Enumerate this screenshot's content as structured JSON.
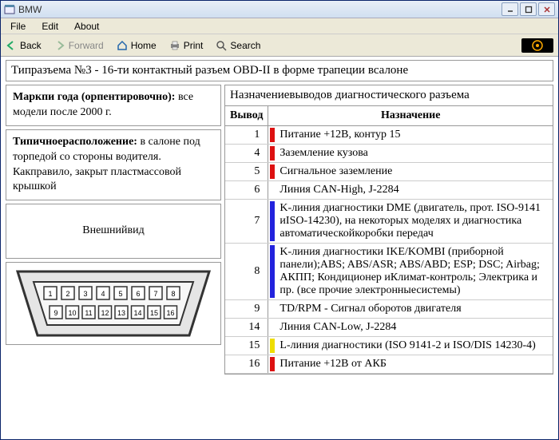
{
  "window": {
    "title": "BMW"
  },
  "menu": {
    "file": "File",
    "edit": "Edit",
    "about": "About"
  },
  "toolbar": {
    "back": "Back",
    "forward": "Forward",
    "home": "Home",
    "print": "Print",
    "search": "Search"
  },
  "header": "Типразъема №3 - 16-ти контактный разъем OBD-II в форме трапеции всалоне",
  "left": {
    "year_label": "Маркпи года (орпентировочно):",
    "year_text": " все модели после 2000 г.",
    "loc_label": "Типичноерасположение:",
    "loc_text": " в салоне под торпедой со стороны водителя. Какправило, закрыт пластмассовой крышкой",
    "view_label": "Внешнийвид"
  },
  "right": {
    "title": "Назначениевыводов диагностического разъема",
    "col_pin": "Вывод",
    "col_desc": "Назначение",
    "rows": [
      {
        "pin": "1",
        "color": "#d11",
        "text": "Питание +12В, контур 15"
      },
      {
        "pin": "4",
        "color": "#d11",
        "text": "Заземление кузова"
      },
      {
        "pin": "5",
        "color": "#d11",
        "text": "Сигнальное заземление"
      },
      {
        "pin": "6",
        "color": "",
        "text": "Линия CAN-High, J-2284"
      },
      {
        "pin": "7",
        "color": "#22d",
        "text": "K-линия диагностики DME (двигатель, прот. ISO-9141 иISO-14230), на некоторых моделях и диагностика автоматическойкоробки передач"
      },
      {
        "pin": "8",
        "color": "#22d",
        "text": "K-линия диагностики IKE/KOMBI (приборной панели);ABS; ABS/ASR; ABS/ABD; ESP; DSC; Airbag; АКПП; Кондиционер иКлимат-контроль; Электрика и пр. (все прочие электронныесистемы)"
      },
      {
        "pin": "9",
        "color": "",
        "text": "TD/RPM - Сигнал оборотов двигателя"
      },
      {
        "pin": "14",
        "color": "",
        "text": "Линия CAN-Low, J-2284"
      },
      {
        "pin": "15",
        "color": "#ed0",
        "text": "L-линия диагностики (ISO 9141-2 и ISO/DIS 14230-4)"
      },
      {
        "pin": "16",
        "color": "#d11",
        "text": "Питание +12В от АКБ"
      }
    ]
  },
  "connector_pins": [
    "1",
    "2",
    "3",
    "4",
    "5",
    "6",
    "7",
    "8",
    "9",
    "10",
    "11",
    "12",
    "13",
    "14",
    "15",
    "16"
  ]
}
